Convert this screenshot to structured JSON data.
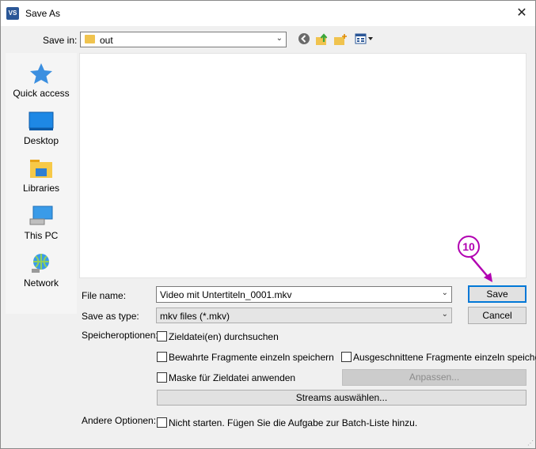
{
  "window": {
    "title": "Save As",
    "app_icon_text": "VS",
    "close_glyph": "✕"
  },
  "toolbar": {
    "save_in_label": "Save in:",
    "folder": "out",
    "icons": [
      "back-icon",
      "up-folder-icon",
      "new-folder-icon",
      "view-menu-icon"
    ]
  },
  "places": [
    {
      "label": "Quick access",
      "icon": "quick-access-star-icon"
    },
    {
      "label": "Desktop",
      "icon": "desktop-icon"
    },
    {
      "label": "Libraries",
      "icon": "libraries-icon"
    },
    {
      "label": "This PC",
      "icon": "this-pc-icon"
    },
    {
      "label": "Network",
      "icon": "network-icon"
    }
  ],
  "file_name": {
    "label": "File name:",
    "value": "Video mit Untertiteln_0001.mkv"
  },
  "save_type": {
    "label": "Save as type:",
    "value": "mkv files (*.mkv)"
  },
  "buttons": {
    "save": "Save",
    "cancel": "Cancel"
  },
  "options": {
    "label": "Speicheroptionen:",
    "search_target": "Zieldatei(en) durchsuchen",
    "keep_fragments": "Bewahrte Fragmente einzeln speichern",
    "cut_fragments": "Ausgeschnittene Fragmente einzeln speichern",
    "apply_mask": "Maske für Zieldatei anwenden",
    "adjust_button": "Anpassen...",
    "streams_button": "Streams auswählen..."
  },
  "other": {
    "label": "Andere Optionen:",
    "no_start": "Nicht starten. Fügen Sie die Aufgabe zur Batch-Liste hinzu."
  },
  "annotation": {
    "step": "10",
    "color": "#b100b1"
  }
}
